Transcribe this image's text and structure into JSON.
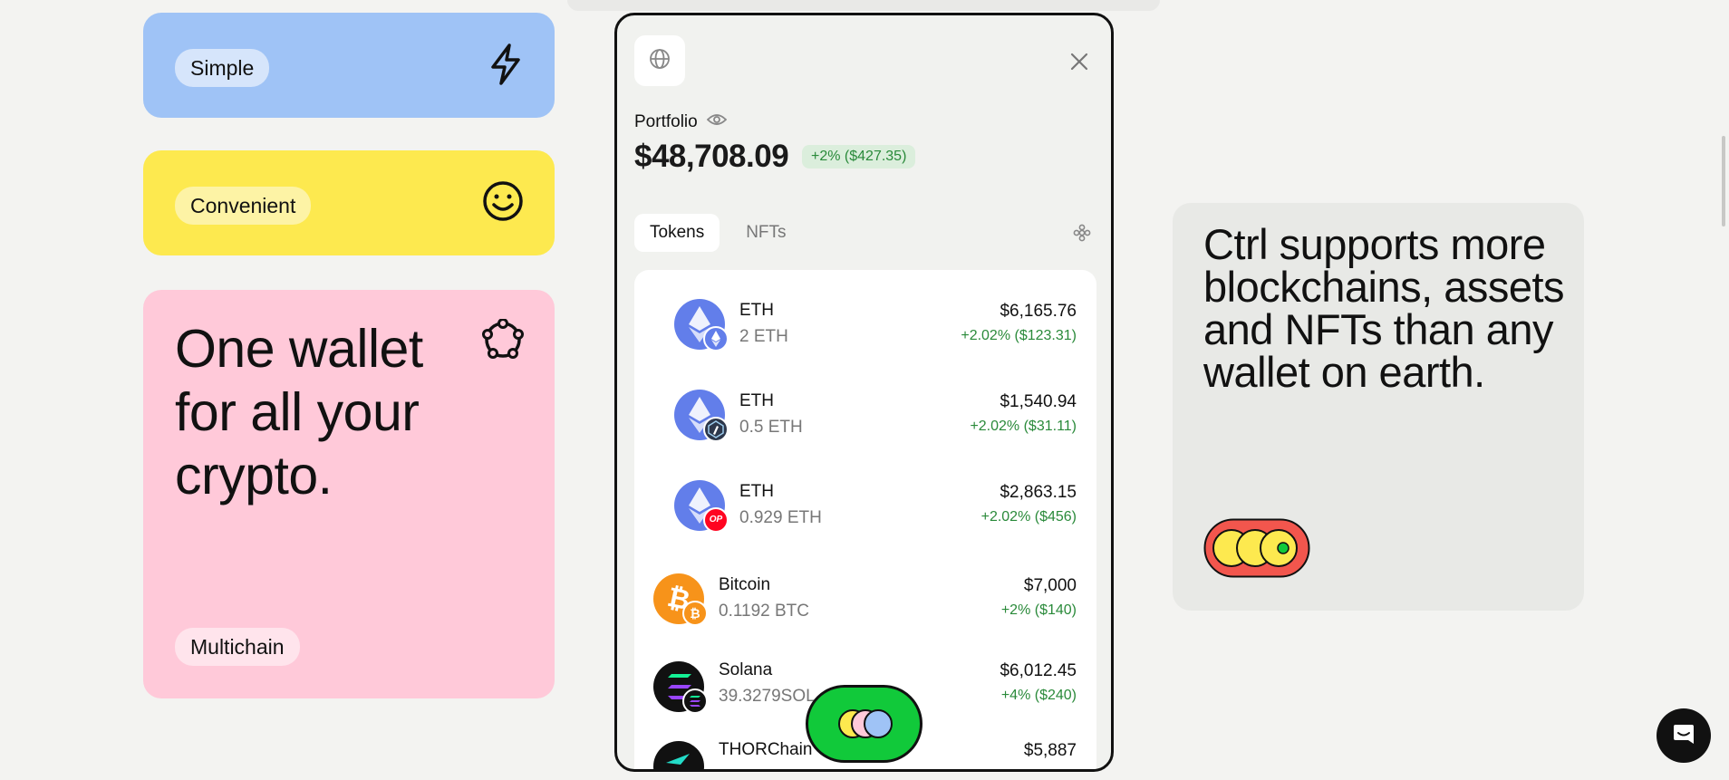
{
  "features": {
    "simple_label": "Simple",
    "convenient_label": "Convenient",
    "multichain_headline": "One wallet for all your crypto.",
    "multichain_label": "Multichain"
  },
  "wallet": {
    "portfolio_label": "Portfolio",
    "balance": "$48,708.09",
    "balance_change": "+2% ($427.35)",
    "tabs": [
      {
        "label": "Tokens",
        "active": true
      },
      {
        "label": "NFTs",
        "active": false
      }
    ],
    "tokens": [
      {
        "name": "ETH",
        "amount": "2 ETH",
        "value": "$6,165.76",
        "change": "+2.02% ($123.31)",
        "logo": "eth-logo-icon",
        "badge": "eth-network-icon"
      },
      {
        "name": "ETH",
        "amount": "0.5 ETH",
        "value": "$1,540.94",
        "change": "+2.02% ($31.11)",
        "logo": "eth-logo-icon",
        "badge": "arbitrum-network-icon"
      },
      {
        "name": "ETH",
        "amount": "0.929 ETH",
        "value": "$2,863.15",
        "change": "+2.02% ($456)",
        "logo": "eth-logo-icon",
        "badge": "optimism-network-icon",
        "badge_text": "OP"
      },
      {
        "name": "Bitcoin",
        "amount": "0.1192 BTC",
        "value": "$7,000",
        "change": "+2% ($140)",
        "logo": "bitcoin-logo-icon",
        "badge": "bitcoin-network-icon"
      },
      {
        "name": "Solana",
        "amount": "39.3279SOL",
        "value": "$6,012.45",
        "change": "+4% ($240)",
        "logo": "solana-logo-icon",
        "badge": "solana-network-icon"
      },
      {
        "name": "THORChain",
        "amount": "",
        "value": "$5,887",
        "change": "",
        "logo": "thorchain-logo-icon"
      }
    ]
  },
  "supports": {
    "headline": "Ctrl supports more blockchains, assets and NFTs than any wallet on earth."
  },
  "colors": {
    "simple_bg": "#9fc3f6",
    "convenient_bg": "#fde94f",
    "multichain_bg": "#ffc9d9",
    "positive": "#2a8a3a",
    "fab_green": "#11c93a"
  }
}
